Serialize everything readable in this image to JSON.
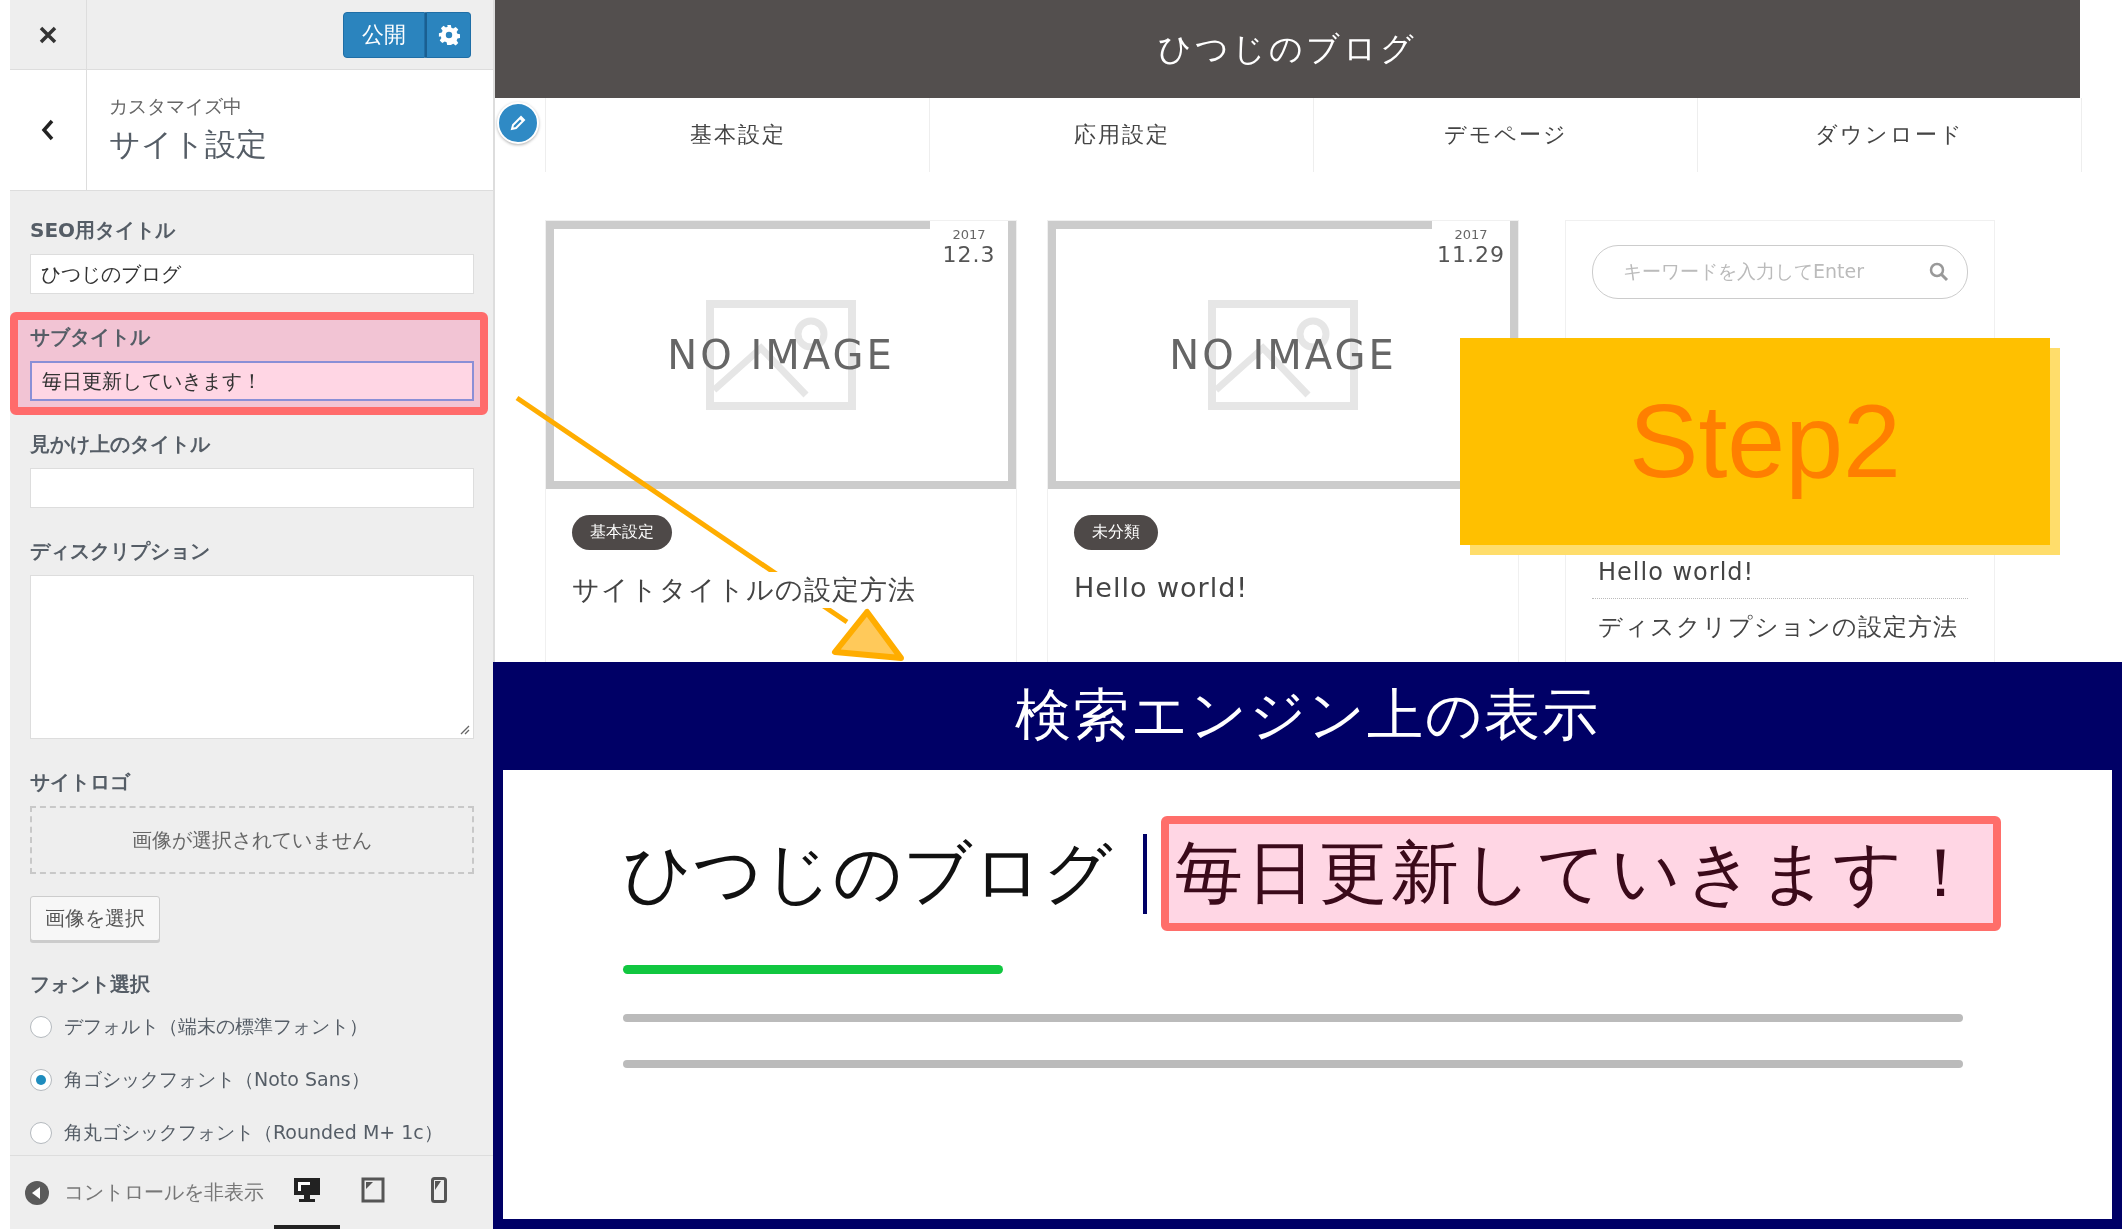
{
  "customizer": {
    "publish_button": "公開",
    "breadcrumb": "カスタマイズ中",
    "section_title": "サイト設定",
    "fields": [
      {
        "kind": "text",
        "label": "SEO用タイトル",
        "value": "ひつじのブログ",
        "highlighted": false
      },
      {
        "kind": "text",
        "label": "サブタイトル",
        "value": "毎日更新していきます！",
        "highlighted": true
      },
      {
        "kind": "text",
        "label": "見かけ上のタイトル",
        "highlighted": false
      },
      {
        "kind": "textarea",
        "label": "ディスクリプション",
        "highlighted": false
      },
      {
        "kind": "image",
        "label": "サイトロゴ",
        "status": "画像が選択されていません",
        "button": "画像を選択",
        "highlighted": false
      },
      {
        "kind": "radio",
        "label": "フォント選択",
        "highlighted": false,
        "options": [
          {
            "label": "デフォルト（端末の標準フォント）",
            "selected": false
          },
          {
            "label": "角ゴシックフォント（Noto Sans）",
            "selected": true
          },
          {
            "label": "角丸ゴシックフォント（Rounded M+ 1c）",
            "selected": false
          }
        ]
      }
    ],
    "footer": {
      "hide_controls": "コントロールを非表示",
      "devices": [
        {
          "kind": "desktop",
          "selected": true
        },
        {
          "kind": "tablet",
          "selected": false
        },
        {
          "kind": "mobile",
          "selected": false
        }
      ]
    }
  },
  "preview": {
    "site_title": "ひつじのブログ",
    "nav": [
      "基本設定",
      "応用設定",
      "デモページ",
      "ダウンロード"
    ],
    "posts": [
      {
        "year": "2017",
        "date": "12.3",
        "image_text": "NO IMAGE",
        "category": "基本設定",
        "title": "サイトタイトルの設定方法"
      },
      {
        "year": "2017",
        "date": "11.29",
        "image_text": "NO IMAGE",
        "category": "未分類",
        "title": "Hello world!"
      }
    ],
    "sidebar": {
      "search_placeholder": "キーワードを入力してEnter",
      "links": [
        "Hello world!",
        "ディスクリプションの設定方法"
      ]
    }
  },
  "annotation": {
    "step_label": "Step2"
  },
  "serp_panel": {
    "title": "検索エンジン上の表示",
    "site_title": "ひつじのブログ",
    "subtitle": "毎日更新していきます！"
  }
}
